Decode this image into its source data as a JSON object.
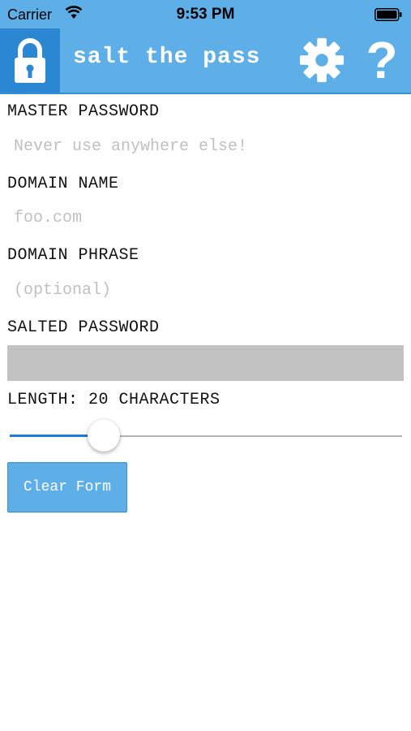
{
  "statusbar": {
    "carrier": "Carrier",
    "time": "9:53 PM"
  },
  "header": {
    "title": "salt the pass",
    "help_glyph": "?"
  },
  "form": {
    "master_password": {
      "label": "MASTER PASSWORD",
      "placeholder": "Never use anywhere else!",
      "value": ""
    },
    "domain_name": {
      "label": "DOMAIN NAME",
      "placeholder": "foo.com",
      "value": ""
    },
    "domain_phrase": {
      "label": "DOMAIN PHRASE",
      "placeholder": "(optional)",
      "value": ""
    },
    "salted_password": {
      "label": "SALTED PASSWORD",
      "value": ""
    },
    "length": {
      "label": "LENGTH: 20 CHARACTERS",
      "value": 20,
      "fraction": 0.24
    },
    "clear_button_label": "Clear Form"
  },
  "colors": {
    "header_bg": "#5eaee8",
    "lock_bg": "#2b87d1",
    "slider_fill": "#1a7be0",
    "output_bg": "#c2c2c2"
  },
  "icons": {
    "lock": "lock-icon",
    "settings": "gear-icon",
    "help": "help-icon",
    "wifi": "wifi-icon",
    "battery": "battery-icon"
  }
}
